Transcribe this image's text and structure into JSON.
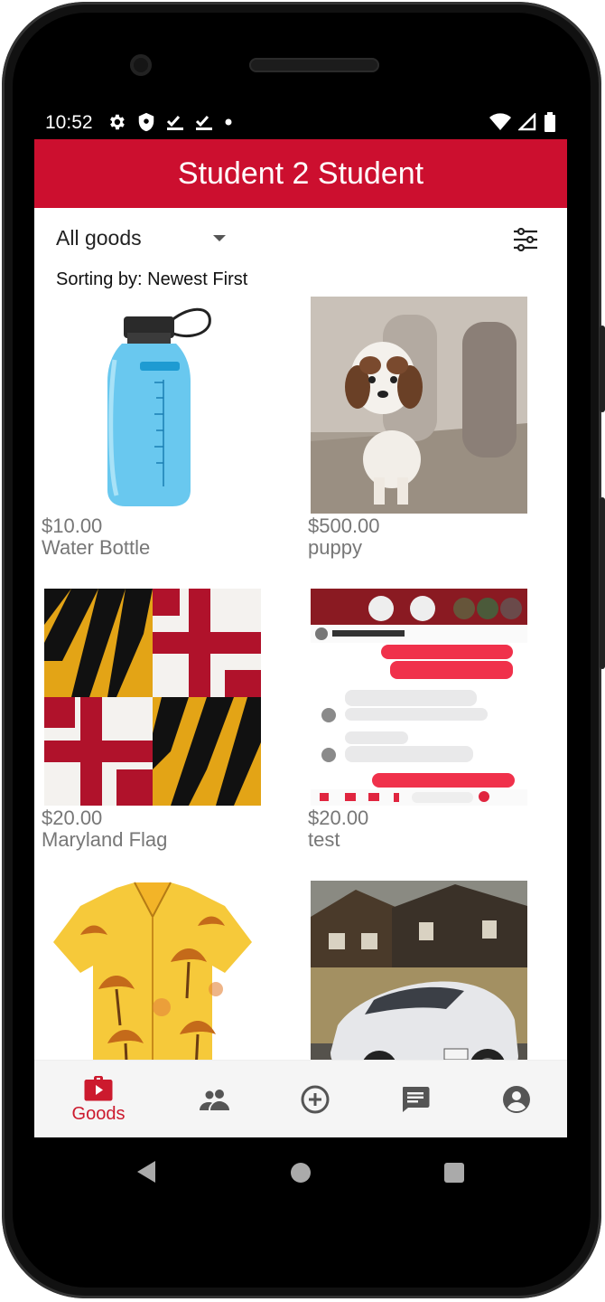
{
  "status_bar": {
    "time": "10:52"
  },
  "app": {
    "title": "Student 2 Student"
  },
  "filter": {
    "category": "All goods"
  },
  "sorting": {
    "label": "Sorting by: Newest First"
  },
  "listings": [
    {
      "price": "$10.00",
      "name": "Water Bottle"
    },
    {
      "price": "$500.00",
      "name": "puppy"
    },
    {
      "price": "$20.00",
      "name": "Maryland Flag"
    },
    {
      "price": "$20.00",
      "name": "test"
    },
    {
      "price": "",
      "name": ""
    },
    {
      "price": "",
      "name": ""
    }
  ],
  "bottom_nav": {
    "active_label": "Goods",
    "accent": "#cc1a2e"
  },
  "theme": {
    "primary": "#cc0f2f"
  }
}
